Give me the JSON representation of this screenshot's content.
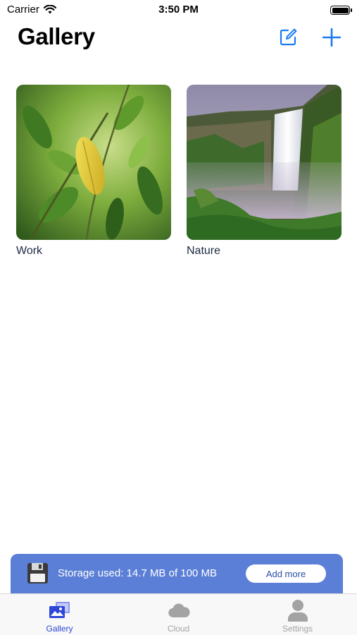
{
  "status_bar": {
    "carrier": "Carrier",
    "time": "3:50 PM"
  },
  "header": {
    "title": "Gallery",
    "compose_icon": "compose-icon",
    "add_icon": "plus-icon",
    "accent_color": "#1a7bf2"
  },
  "albums": [
    {
      "name": "Work",
      "thumbnail": "green-leaves-photo"
    },
    {
      "name": "Nature",
      "thumbnail": "waterfall-photo"
    }
  ],
  "storage": {
    "text": "Storage used: 14.7 MB of 100 MB",
    "button_label": "Add more",
    "banner_color": "#5b7fd6"
  },
  "tabs": [
    {
      "label": "Gallery",
      "icon": "photos-icon",
      "active": true
    },
    {
      "label": "Cloud",
      "icon": "cloud-icon",
      "active": false
    },
    {
      "label": "Settings",
      "icon": "person-icon",
      "active": false
    }
  ]
}
